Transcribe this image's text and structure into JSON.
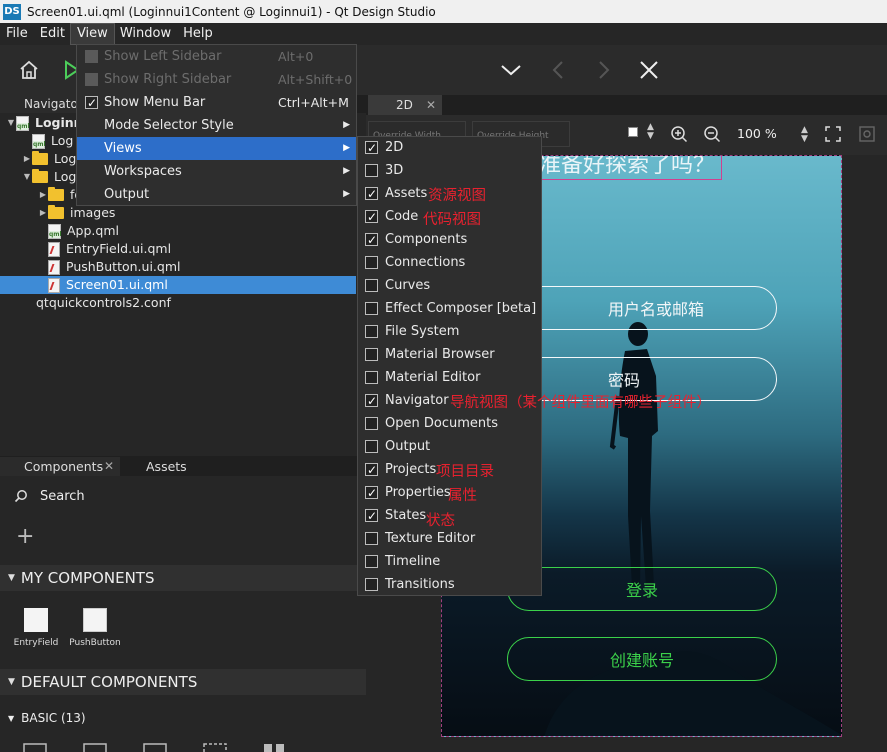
{
  "window": {
    "logo": "DS",
    "title": "Screen01.ui.qml (Loginnui1Content @ Loginnui1) - Qt Design Studio"
  },
  "menubar": [
    "File",
    "Edit",
    "View",
    "Window",
    "Help"
  ],
  "navigator": {
    "tab": "Navigato"
  },
  "tree": [
    {
      "label": "Loginn",
      "indent": 0,
      "icon": "qml",
      "arrow": "down",
      "bold": true
    },
    {
      "label": "Log",
      "indent": 1,
      "icon": "qml",
      "arrow": ""
    },
    {
      "label": "Log",
      "indent": 1,
      "icon": "folder",
      "arrow": "right"
    },
    {
      "label": "Log",
      "indent": 1,
      "icon": "folder",
      "arrow": "down"
    },
    {
      "label": "fo",
      "indent": 2,
      "icon": "folder",
      "arrow": "right"
    },
    {
      "label": "images",
      "indent": 2,
      "icon": "folder",
      "arrow": "right"
    },
    {
      "label": "App.qml",
      "indent": 2,
      "icon": "qml",
      "arrow": ""
    },
    {
      "label": "EntryField.ui.qml",
      "indent": 2,
      "icon": "file",
      "arrow": ""
    },
    {
      "label": "PushButton.ui.qml",
      "indent": 2,
      "icon": "file",
      "arrow": ""
    },
    {
      "label": "Screen01.ui.qml",
      "indent": 2,
      "icon": "file",
      "arrow": "",
      "selected": true
    },
    {
      "label": "qtquickcontrols2.conf",
      "indent": 1,
      "icon": "blank",
      "arrow": ""
    }
  ],
  "components_panel": {
    "tabs": [
      "Components",
      "Assets"
    ],
    "search_label": "Search",
    "add_symbol": "+",
    "my_components": "MY COMPONENTS",
    "items": [
      "EntryField",
      "PushButton"
    ],
    "default_components": "DEFAULT COMPONENTS",
    "basic": "BASIC (13)"
  },
  "editor": {
    "tab": "2D",
    "override_width": "Override Width",
    "override_height": "Override Height",
    "zoom": "100 %"
  },
  "canvas": {
    "title": "准备好探索了吗？",
    "username_placeholder": "用户名或邮箱",
    "password_placeholder": "密码",
    "login_button": "登录",
    "create_account_button": "创建账号",
    "accent": "#3bd14a"
  },
  "view_menu": [
    {
      "label": "Show Left Sidebar",
      "shortcut": "Alt+0",
      "check": true,
      "checked": false,
      "disabled": true
    },
    {
      "label": "Show Right Sidebar",
      "shortcut": "Alt+Shift+0",
      "check": true,
      "checked": false,
      "disabled": true
    },
    {
      "label": "Show Menu Bar",
      "shortcut": "Ctrl+Alt+M",
      "check": true,
      "checked": true,
      "disabled": false
    },
    {
      "label": "Mode Selector Style",
      "shortcut": "",
      "check": false,
      "submenu": true
    },
    {
      "label": "Views",
      "shortcut": "",
      "check": false,
      "submenu": true,
      "highlight": true
    },
    {
      "label": "Workspaces",
      "shortcut": "",
      "check": false,
      "submenu": true
    },
    {
      "label": "Output",
      "shortcut": "",
      "check": false,
      "submenu": true
    }
  ],
  "views_submenu": [
    {
      "label": "2D",
      "checked": true
    },
    {
      "label": "3D",
      "checked": false
    },
    {
      "label": "Assets",
      "checked": true
    },
    {
      "label": "Code",
      "checked": true
    },
    {
      "label": "Components",
      "checked": true
    },
    {
      "label": "Connections",
      "checked": false
    },
    {
      "label": "Curves",
      "checked": false
    },
    {
      "label": "Effect Composer [beta]",
      "checked": false
    },
    {
      "label": "File System",
      "checked": false
    },
    {
      "label": "Material Browser",
      "checked": false
    },
    {
      "label": "Material Editor",
      "checked": false
    },
    {
      "label": "Navigator",
      "checked": true
    },
    {
      "label": "Open Documents",
      "checked": false
    },
    {
      "label": "Output",
      "checked": false
    },
    {
      "label": "Projects",
      "checked": true
    },
    {
      "label": "Properties",
      "checked": true
    },
    {
      "label": "States",
      "checked": true
    },
    {
      "label": "Texture Editor",
      "checked": false
    },
    {
      "label": "Timeline",
      "checked": false
    },
    {
      "label": "Transitions",
      "checked": false
    }
  ],
  "annotations": {
    "assets": "资源视图",
    "code": "代码视图",
    "navigator": "导航视图（某个组件里面有哪些子组件）",
    "projects": "项目目录",
    "properties": "属性",
    "states": "状态",
    "color": "#e8212f"
  }
}
